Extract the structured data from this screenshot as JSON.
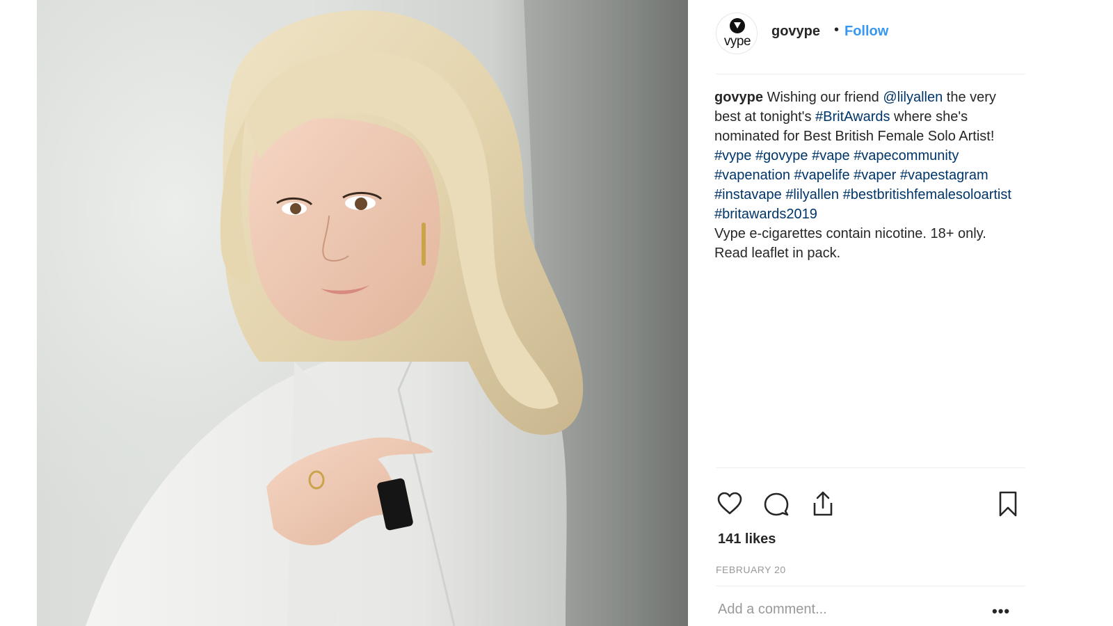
{
  "post": {
    "image_alt": "Portrait of a blonde woman in a white blazer holding a black vape device"
  },
  "header": {
    "logo_text": "vype",
    "username": "govype",
    "separator": "•",
    "follow_label": "Follow"
  },
  "caption": {
    "username": "govype",
    "text_1": " Wishing our friend ",
    "mention": "@lilyallen",
    "text_2": " the very best at tonight's ",
    "hashtag_brit": "#BritAwards",
    "text_3": " where she's nominated for Best British Female Solo Artist!",
    "hashtags": [
      "#vype",
      "#govype",
      "#vape",
      "#vapecommunity",
      "#vapenation",
      "#vapelife",
      "#vaper",
      "#vapestagram",
      "#instavape",
      "#lilyallen",
      "#bestbritishfemalesoloartist",
      "#britawards2019"
    ],
    "disclaimer": "Vype e-cigarettes contain nicotine. 18+ only. Read leaflet in pack."
  },
  "actions": {
    "like_icon": "heart-icon",
    "comment_icon": "comment-icon",
    "share_icon": "share-icon",
    "save_icon": "bookmark-icon"
  },
  "likes": "141 likes",
  "date": "FEBRUARY 20",
  "comment_placeholder": "Add a comment...",
  "more_label": "•••",
  "colors": {
    "link_blue": "#3897f0",
    "hashtag_navy": "#003569",
    "text": "#262626",
    "muted": "#999999"
  }
}
